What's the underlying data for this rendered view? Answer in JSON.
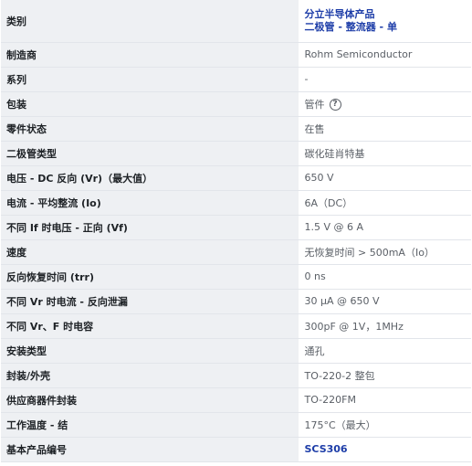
{
  "rows": [
    {
      "label": "类别",
      "value_line1": "分立半导体产品",
      "value_line2": "二极管 - 整流器 - 单"
    },
    {
      "label": "制造商",
      "value": "Rohm Semiconductor"
    },
    {
      "label": "系列",
      "value": "-"
    },
    {
      "label": "包装",
      "value": "管件",
      "icon": "help-circle-icon"
    },
    {
      "label": "零件状态",
      "value": "在售"
    },
    {
      "label": "二极管类型",
      "value": "碳化硅肖特基"
    },
    {
      "label": "电压 - DC 反向 (Vr)（最大值）",
      "value": "650 V"
    },
    {
      "label": "电流 - 平均整流 (Io)",
      "value": "6A（DC）"
    },
    {
      "label": "不同 If 时电压 - 正向 (Vf)",
      "value": "1.5 V @ 6 A"
    },
    {
      "label": "速度",
      "value": "无恢复时间 > 500mA（Io）"
    },
    {
      "label": "反向恢复时间 (trr)",
      "value": "0 ns"
    },
    {
      "label": "不同 Vr 时电流 - 反向泄漏",
      "value": "30 µA @ 650 V"
    },
    {
      "label": "不同 Vr、F 时电容",
      "value": "300pF @ 1V，1MHz"
    },
    {
      "label": "安装类型",
      "value": "通孔"
    },
    {
      "label": "封装/外壳",
      "value": "TO-220-2 整包"
    },
    {
      "label": "供应商器件封装",
      "value": "TO-220FM"
    },
    {
      "label": "工作温度 - 结",
      "value": "175°C（最大）"
    },
    {
      "label": "基本产品编号",
      "value": "SCS306"
    }
  ],
  "colors": {
    "label_bg": "#eef0f3",
    "link": "#1d3da8",
    "value_text": "#5a5f66"
  }
}
